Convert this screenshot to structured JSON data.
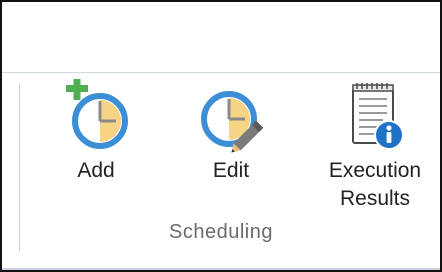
{
  "ribbon": {
    "group": {
      "label": "Scheduling",
      "buttons": [
        {
          "label": "Add",
          "icon": "add-schedule-icon"
        },
        {
          "label": "Edit",
          "icon": "edit-schedule-icon"
        },
        {
          "label_line1": "Execution",
          "label_line2": "Results",
          "icon": "execution-results-icon"
        }
      ]
    }
  },
  "colors": {
    "clock_ring": "#3c8fd6",
    "clock_face": "#f7d485",
    "plus_green": "#4caf50",
    "info_blue": "#1e73c8"
  }
}
